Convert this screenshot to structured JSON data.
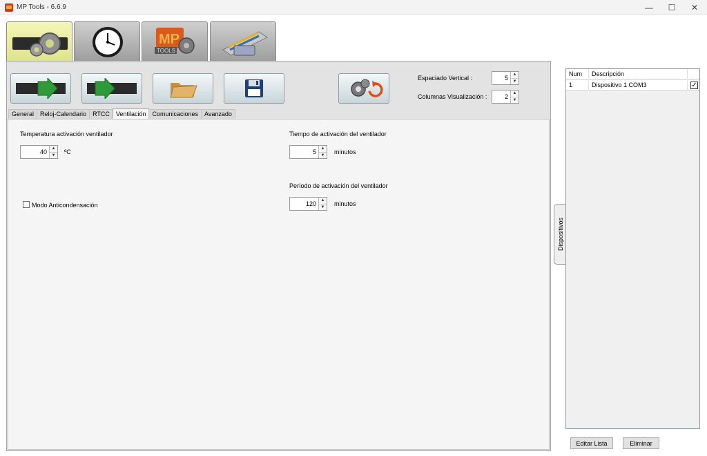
{
  "window": {
    "title": "MP Tools - 6.6.9",
    "minimize": "—",
    "maximize": "☐",
    "close": "✕"
  },
  "main_tabs": [
    {
      "name": "settings",
      "icon": "gear-icon",
      "active": true
    },
    {
      "name": "clock",
      "icon": "clock-icon"
    },
    {
      "name": "mp-tools",
      "icon": "mp-tools-logo-icon"
    },
    {
      "name": "connection",
      "icon": "serial-cable-icon"
    }
  ],
  "toolbar": {
    "buttons": [
      {
        "name": "read-config",
        "icon": "arrow-right-green-icon"
      },
      {
        "name": "write-config",
        "icon": "arrow-right-green-icon"
      },
      {
        "name": "open-file",
        "icon": "folder-icon"
      },
      {
        "name": "save-file",
        "icon": "floppy-disk-icon"
      },
      {
        "name": "reset-defaults",
        "icon": "gears-reset-icon"
      }
    ],
    "vertical_spacing_label": "Espaciado Vertical :",
    "vertical_spacing_value": "5",
    "columns_label": "Columnas Visualización :",
    "columns_value": "2"
  },
  "sub_tabs": [
    "General",
    "Reloj-Calendario",
    "RTCC",
    "Ventilación",
    "Comunicaciones",
    "Avanzado"
  ],
  "sub_tab_active": "Ventilación",
  "form": {
    "temp_label": "Temperatura activación ventilador",
    "temp_value": "40",
    "temp_unit": "ºC",
    "anticondensation_label": "Modo Anticondensación",
    "anticondensation_checked": false,
    "time_label": "Tiempo de activación del ventilador",
    "time_value": "5",
    "time_unit": "minutos",
    "period_label": "Período de activación del ventilador",
    "period_value": "120",
    "period_unit": "minutos"
  },
  "devices": {
    "side_tab_label": "Dispositivos",
    "columns": [
      "Num",
      "Descripción"
    ],
    "rows": [
      {
        "num": "1",
        "description": "Dispositivo 1 COM3",
        "checked": true
      }
    ],
    "edit_button": "Editar Lista",
    "delete_button": "Eliminar"
  }
}
